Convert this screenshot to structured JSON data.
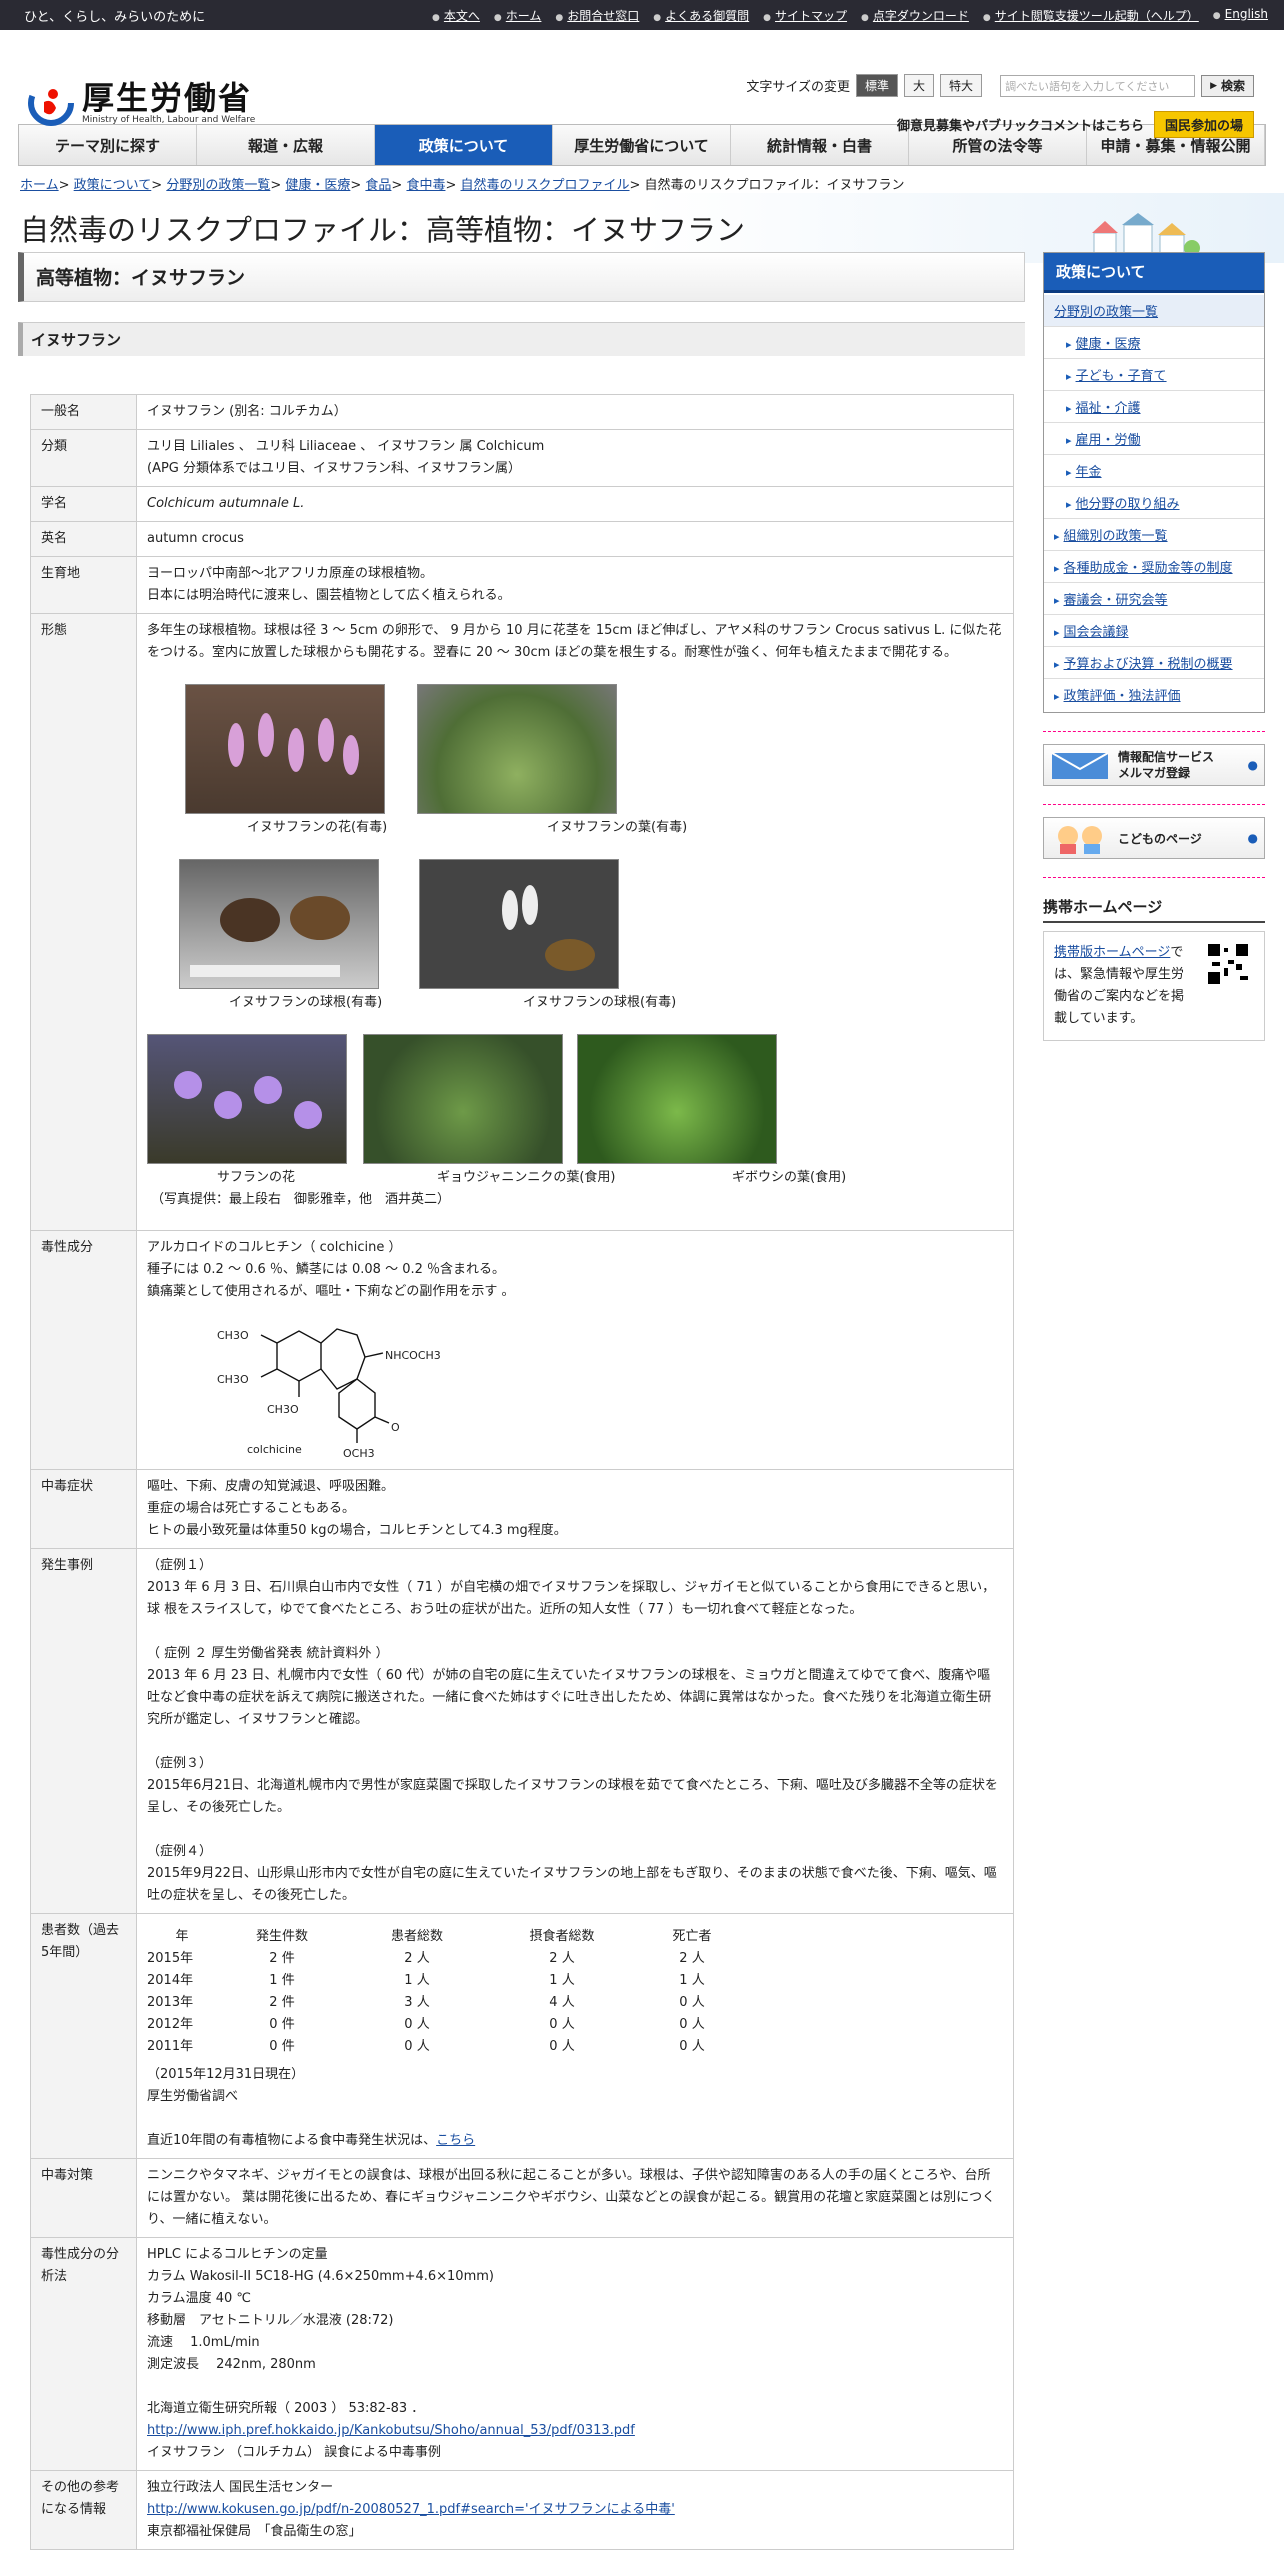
{
  "topbar": {
    "tagline": "ひと、くらし、みらいのために",
    "links": [
      "本文へ",
      "ホーム",
      "お問合せ窓口",
      "よくある御質問",
      "サイトマップ",
      "点字ダウンロード",
      "サイト閲覧支援ツール起動（ヘルプ）",
      "English"
    ]
  },
  "logo": {
    "jp": "厚生労働省",
    "en": "Ministry of Health, Labour and Welfare"
  },
  "header": {
    "font_size_label": "文字サイズの変更",
    "font_sizes": [
      "標準",
      "大",
      "特大"
    ],
    "search_placeholder": "調べたい語句を入力してください",
    "search_button": "検索",
    "public_comment": "御意見募集やパブリックコメントはこちら",
    "kokumin": "国民参加の場"
  },
  "nav": [
    "テーマ別に探す",
    "報道・広報",
    "政策について",
    "厚生労働省について",
    "統計情報・白書",
    "所管の法令等",
    "申請・募集・情報公開"
  ],
  "breadcrumb": [
    "ホーム",
    "政策について",
    "分野別の政策一覧",
    "健康・医療",
    "食品",
    "食中毒",
    "自然毒のリスクプロファイル",
    "自然毒のリスクプロファイル：イヌサフラン"
  ],
  "page_title": "自然毒のリスクプロファイル：高等植物：イヌサフラン",
  "h2": "高等植物：イヌサフラン",
  "h3": "イヌサフラン",
  "rows": {
    "common_k": "一般名",
    "common_v": "イヌサフラン (別名: コルチカム）",
    "class_k": "分類",
    "class_v1": "ユリ目 Liliales 、 ユリ科 Liliaceae 、 イヌサフラン 属 Colchicum",
    "class_v2": "(APG 分類体系ではユリ目、イヌサフラン科、イヌサフラン属）",
    "sci_k": "学名",
    "sci_v": "Colchicum autumnale L.",
    "en_k": "英名",
    "en_v": "autumn crocus",
    "hab_k": "生育地",
    "hab_v1": "ヨーロッパ中南部～北アフリカ原産の球根植物。",
    "hab_v2": "日本には明治時代に渡来し、園芸植物として広く植えられる。",
    "morph_k": "形態",
    "morph_v": "多年生の球根植物。球根は径 3 ～ 5cm の卵形で、 9 月から 10 月に花茎を 15cm ほど伸ばし、アヤメ科のサフラン Crocus sativus L. に似た花をつける。室内に放置した球根からも開花する。翌春に 20 ～ 30cm ほどの葉を根生する。耐寒性が強く、何年も植えたままで開花する。",
    "photo_caps": [
      "イヌサフランの花(有毒)",
      "イヌサフランの葉(有毒)",
      "イヌサフランの球根(有毒)",
      "イヌサフランの球根(有毒)",
      "サフランの花",
      "ギョウジャニンニクの葉(食用)",
      "ギボウシの葉(食用)"
    ],
    "photo_credit": "（写真提供：最上段右　御影雅幸，他　酒井英二）",
    "tox_k": "毒性成分",
    "tox_v1": "アルカロイドのコルヒチン（ colchicine ）",
    "tox_v2": "種子には 0.2 ～ 0.6 ％、鱗茎には 0.08 ～ 0.2 ％含まれる。",
    "tox_v3": "鎮痛薬として使用されるが、嘔吐・下痢などの副作用を示す 。",
    "chem": {
      "a": "CH3O",
      "b": "CH3O",
      "c": "CH3O",
      "d": "NHCOCH3",
      "e": "O",
      "f": "OCH3",
      "name": "colchicine"
    },
    "symp_k": "中毒症状",
    "symp_v1": "嘔吐、下痢、皮膚の知覚減退、呼吸困難。",
    "symp_v2": "重症の場合は死亡することもある。",
    "symp_v3": "ヒトの最小致死量は体重50 kgの場合，コルヒチンとして4.3 mg程度。",
    "case_k": "発生事例",
    "case1_t": "（症例１）",
    "case1": "2013 年 6 月 3 日、石川県白山市内で女性（ 71 ）が自宅横の畑でイヌサフランを採取し、ジャガイモと似ていることから食用にできると思い，球 根をスライスして，ゆでて食べたところ、おう吐の症状が出た。近所の知人女性（ 77 ）も一切れ食べて軽症となった。",
    "case2_t": "（ 症例 ２ 厚生労働省発表 統計資料外 ）",
    "case2": "2013 年 6 月 23 日、札幌市内で女性（ 60 代）が姉の自宅の庭に生えていたイヌサフランの球根を、ミョウガと間違えてゆでて食べ、腹痛や嘔吐など食中毒の症状を訴えて病院に搬送された。一緒に食べた姉はすぐに吐き出したため、体調に異常はなかった。食べた残りを北海道立衛生研究所が鑑定し、イヌサフランと確認。",
    "case3_t": "（症例３）",
    "case3": "2015年6月21日、北海道札幌市内で男性が家庭菜園で採取したイヌサフランの球根を茹でて食べたところ、下痢、嘔吐及び多臓器不全等の症状を呈し、その後死亡した。",
    "case4_t": "（症例４）",
    "case4": "2015年9月22日、山形県山形市内で女性が自宅の庭に生えていたイヌサフランの地上部をもぎ取り、そのままの状態で食べた後、下痢、嘔気、嘔吐の症状を呈し、その後死亡した。",
    "pat_k": "患者数（過去 5年間）",
    "stats_head": [
      "年",
      "発生件数",
      "患者総数",
      "摂食者総数",
      "死亡者"
    ],
    "stats": [
      [
        "2015年",
        "2 件",
        "2 人",
        "2 人",
        "2 人"
      ],
      [
        "2014年",
        "1 件",
        "1 人",
        "1 人",
        "1 人"
      ],
      [
        "2013年",
        "2 件",
        "3 人",
        "4 人",
        "0 人"
      ],
      [
        "2012年",
        "0 件",
        "0 人",
        "0 人",
        "0 人"
      ],
      [
        "2011年",
        "0 件",
        "0 人",
        "0 人",
        "0 人"
      ]
    ],
    "stats_date": "（2015年12月31日現在）",
    "stats_src": "厚生労働省調べ",
    "stats_recent": "直近10年間の有毒植物による食中毒発生状況は、",
    "stats_link": "こちら",
    "meas_k": "中毒対策",
    "meas_v": "ニンニクやタマネギ、ジャガイモとの誤食は、球根が出回る秋に起こることが多い。球根は、子供や認知障害のある人の手の届くところや、台所には置かない。 葉は開花後に出るため、春にギョウジャニンニクやギボウシ、山菜などとの誤食が起こる。観賞用の花壇と家庭菜園とは別につくり、一緒に植えない。",
    "anal_k": "毒性成分の分析法",
    "anal": [
      "HPLC によるコルヒチンの定量",
      "カラム Wakosil-II 5C18-HG (4.6×250mm+4.6×10mm)",
      "カラム温度 40 ℃",
      "移動層　アセトニトリル／水混液 (28:72)",
      "流速　 1.0mL/min",
      "測定波長　 242nm, 280nm"
    ],
    "anal_ref": "北海道立衛生研究所報（ 2003 ） 53:82-83 ．",
    "anal_url": "http://www.iph.pref.hokkaido.jp/Kankobutsu/Shoho/annual_53/pdf/0313.pdf",
    "anal_ref2": "イヌサフラン （コルチカム） 誤食による中毒事例",
    "ref_k": "その他の参考になる情報",
    "ref1": "独立行政法人 国民生活センター",
    "ref_url": "http://www.kokusen.go.jp/pdf/n-20080527_1.pdf#search='イヌサフランによる中毒'",
    "ref2": "東京都福祉保健局　「食品衛生の窓」"
  },
  "side": {
    "head": "政策について",
    "items": [
      "分野別の政策一覧",
      "健康・医療",
      "子ども・子育て",
      "福祉・介護",
      "雇用・労働",
      "年金",
      "他分野の取り組み",
      "組織別の政策一覧",
      "各種助成金・奨励金等の制度",
      "審議会・研究会等",
      "国会会議録",
      "予算および決算・税制の概要",
      "政策評価・独法評価"
    ],
    "mail1": "情報配信サービス",
    "mail2": "メルマガ登録",
    "kids": "こどものページ",
    "mobile_title": "携帯ホームページ",
    "mobile_link": "携帯版ホームページ",
    "mobile_text": "では、緊急情報や厚生労働省のご案内などを掲載しています。"
  }
}
